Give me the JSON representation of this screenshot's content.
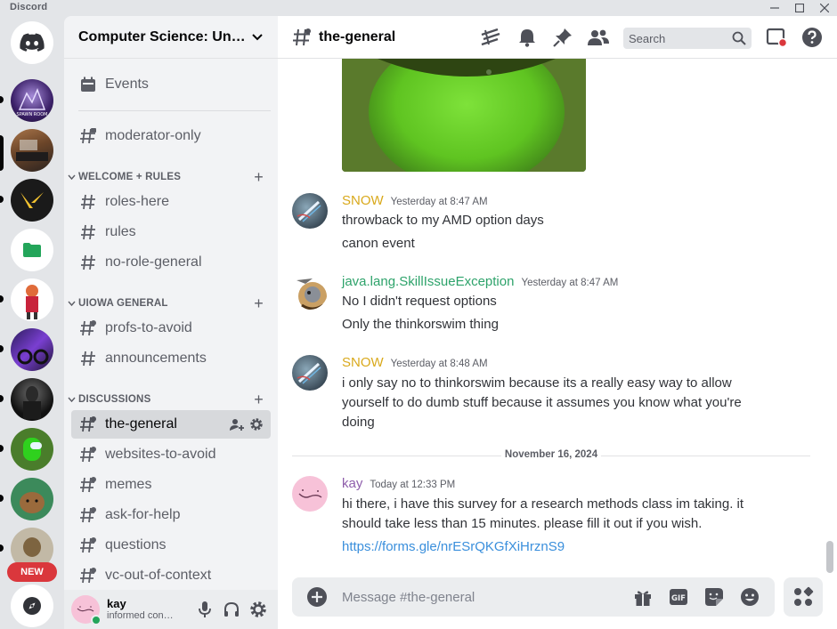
{
  "app": {
    "name": "Discord"
  },
  "window_controls": [
    "minimize-icon",
    "maximize-icon",
    "close-icon"
  ],
  "rail": {
    "new_badge": "NEW",
    "servers": [
      {
        "name": "discord-home",
        "icon": "discord-logo-icon"
      },
      {
        "name": "server-spawn-room"
      },
      {
        "name": "server-desk-photo"
      },
      {
        "name": "server-valorant"
      },
      {
        "name": "server-folder",
        "icon": "folder-icon"
      },
      {
        "name": "server-anime"
      },
      {
        "name": "server-purple-bike"
      },
      {
        "name": "server-dark-figure"
      },
      {
        "name": "server-among-us"
      },
      {
        "name": "server-capybara"
      },
      {
        "name": "server-dog"
      },
      {
        "name": "explore-servers",
        "icon": "compass-icon"
      }
    ]
  },
  "sidebar": {
    "guild_name": "Computer Science: Unde…",
    "events_label": "Events",
    "channels_top": [
      {
        "name": "moderator-only"
      }
    ],
    "categories": [
      {
        "label": "WELCOME + RULES",
        "channels": [
          "roles-here",
          "rules",
          "no-role-general"
        ]
      },
      {
        "label": "UIOWA GENERAL",
        "channels": [
          "profs-to-avoid",
          "announcements"
        ]
      },
      {
        "label": "DISCUSSIONS",
        "channels": [
          "the-general",
          "websites-to-avoid",
          "memes",
          "ask-for-help",
          "questions",
          "vc-out-of-context"
        ]
      }
    ],
    "active_channel": "the-general"
  },
  "user_panel": {
    "name": "kay",
    "status_text": "informed con…",
    "status_color": "#23a55a"
  },
  "header": {
    "channel": "the-general",
    "search_placeholder": "Search",
    "icons": [
      "threads-icon",
      "notification-bell-icon",
      "pin-icon",
      "members-icon",
      "inbox-icon",
      "help-icon"
    ]
  },
  "messages": [
    {
      "author": "SNOW",
      "author_color": "#d9a91c",
      "timestamp": "Yesterday at 8:47 AM",
      "lines": [
        "throwback to my AMD option days",
        "canon event"
      ]
    },
    {
      "author": "java.lang.SkillIssueException",
      "author_color": "#2ea36b",
      "timestamp": "Yesterday at 8:47 AM",
      "lines": [
        "No I didn't request options",
        "Only the thinkorswim thing"
      ]
    },
    {
      "author": "SNOW",
      "author_color": "#d9a91c",
      "timestamp": "Yesterday at 8:48 AM",
      "lines": [
        "i only say no to thinkorswim because its a really easy way to allow",
        "yourself to do dumb stuff because it assumes you know what you're",
        "doing"
      ]
    },
    {
      "author": "kay",
      "author_color": "#8e5dab",
      "timestamp": "Today at 12:33 PM",
      "lines": [
        "hi there, i have this survey for a research methods class im taking. it",
        "should take less than 15 minutes. please fill it out if you wish."
      ],
      "link": "https://forms.gle/nrESrQKGfXiHrznS9"
    }
  ],
  "date_divider": "November 16, 2024",
  "composer": {
    "placeholder": "Message #the-general",
    "gif_label": "GIF"
  }
}
